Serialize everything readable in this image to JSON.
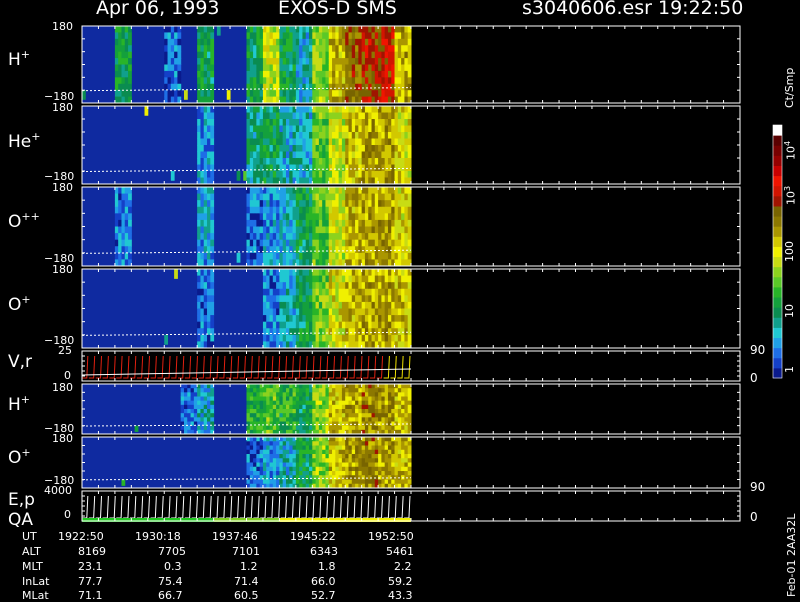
{
  "header": {
    "date": "Apr 06, 1993",
    "instrument": "EXOS-D SMS",
    "file": "s3040606.esr",
    "time": "19:22:50"
  },
  "colorbar": {
    "title": "Ct/Smp",
    "tick_labels": [
      "1",
      "10",
      "100",
      "10",
      "10"
    ],
    "tick_exponents": [
      "",
      "",
      "",
      "3",
      "4"
    ],
    "colors": [
      "#0a1a8c",
      "#1440c8",
      "#1e6ee6",
      "#20a0e6",
      "#20c8d2",
      "#10a08c",
      "#0a8c50",
      "#14a03c",
      "#28b428",
      "#5ac828",
      "#8cd21e",
      "#c8dc14",
      "#f0f000",
      "#d2c800",
      "#aa9600",
      "#8c7800",
      "#786400",
      "#a01400",
      "#d21400",
      "#f01400",
      "#c80000",
      "#960000",
      "#780000",
      "#5a0000",
      "#ffffff"
    ]
  },
  "panels": [
    {
      "label": "H",
      "sup": "+",
      "ymax": "180",
      "ymin": "−180"
    },
    {
      "label": "He",
      "sup": "+",
      "ymax": "180",
      "ymin": "−180"
    },
    {
      "label": "O",
      "sup": "++",
      "ymax": "180",
      "ymin": "−180"
    },
    {
      "label": "O",
      "sup": "+",
      "ymax": "180",
      "ymin": "−180"
    },
    {
      "label": "V,r",
      "sup": "",
      "ymax": "25",
      "ymin": "0",
      "rmax": "90",
      "rmin": "0"
    },
    {
      "label": "H",
      "sup": "+",
      "ymax": "180",
      "ymin": "−180"
    },
    {
      "label": "O",
      "sup": "+",
      "ymax": "180",
      "ymin": "−180"
    },
    {
      "label": "E,p",
      "label2": "QA",
      "sup": "",
      "ymax": "4000",
      "ymin": "0",
      "rmax": "90",
      "rmin": "0"
    }
  ],
  "footer": {
    "rows": [
      {
        "key": "UT",
        "values": [
          "1922:50",
          "1930:18",
          "1937:46",
          "1945:22",
          "1952:50"
        ]
      },
      {
        "key": "ALT",
        "values": [
          "8169",
          "7705",
          "7101",
          "6343",
          "5461"
        ]
      },
      {
        "key": "MLT",
        "values": [
          "23.1",
          "0.3",
          "1.2",
          "1.8",
          "2.2"
        ]
      },
      {
        "key": "InLat",
        "values": [
          "77.7",
          "75.4",
          "71.4",
          "66.0",
          "59.2"
        ]
      },
      {
        "key": "MLat",
        "values": [
          "71.1",
          "66.7",
          "60.5",
          "52.7",
          "43.3"
        ]
      }
    ],
    "side_label": "Feb-01 2AA32L"
  },
  "chart_data": {
    "type": "heatmap",
    "title": "Apr 06, 1993   EXOS-D SMS",
    "time_labels": [
      "1922:50",
      "1930:18",
      "1937:46",
      "1945:22",
      "1952:50"
    ],
    "data_end_fraction": 0.5,
    "colorbar_units": "Ct/Smp",
    "colorbar_range": [
      1,
      10000
    ],
    "colorbar_scale": "log",
    "series": [
      {
        "name": "H+",
        "ylim": [
          -180,
          180
        ],
        "intensity_profile": [
          0.05,
          0.05,
          0.3,
          0.05,
          0.05,
          0.1,
          0.05,
          0.3,
          0.05,
          0.05,
          0.3,
          0.5,
          0.3,
          0.2,
          0.45,
          0.6,
          0.7,
          0.75,
          0.78,
          0.62
        ]
      },
      {
        "name": "He+",
        "ylim": [
          -180,
          180
        ],
        "intensity_profile": [
          0.04,
          0.04,
          0.08,
          0.04,
          0.04,
          0.05,
          0.05,
          0.15,
          0.05,
          0.05,
          0.25,
          0.3,
          0.2,
          0.2,
          0.4,
          0.5,
          0.58,
          0.62,
          0.64,
          0.55
        ]
      },
      {
        "name": "O++",
        "ylim": [
          -180,
          180
        ],
        "intensity_profile": [
          0.04,
          0.04,
          0.12,
          0.04,
          0.04,
          0.05,
          0.05,
          0.16,
          0.05,
          0.05,
          0.1,
          0.15,
          0.18,
          0.3,
          0.4,
          0.52,
          0.6,
          0.63,
          0.64,
          0.56
        ]
      },
      {
        "name": "O+",
        "ylim": [
          -180,
          180
        ],
        "intensity_profile": [
          0.04,
          0.04,
          0.08,
          0.04,
          0.04,
          0.05,
          0.05,
          0.1,
          0.05,
          0.05,
          0.08,
          0.12,
          0.2,
          0.3,
          0.42,
          0.54,
          0.6,
          0.62,
          0.63,
          0.57
        ]
      },
      {
        "name": "V,r",
        "ylim": [
          0,
          25
        ],
        "rlim": [
          0,
          90
        ],
        "type": "line"
      },
      {
        "name": "H+",
        "ylim": [
          -180,
          180
        ],
        "intensity_profile": [
          0.04,
          0.04,
          0.04,
          0.04,
          0.04,
          0.05,
          0.1,
          0.2,
          0.05,
          0.05,
          0.35,
          0.4,
          0.35,
          0.3,
          0.45,
          0.58,
          0.62,
          0.66,
          0.64,
          0.6
        ]
      },
      {
        "name": "O+",
        "ylim": [
          -180,
          180
        ],
        "intensity_profile": [
          0.04,
          0.04,
          0.04,
          0.04,
          0.04,
          0.04,
          0.05,
          0.06,
          0.05,
          0.05,
          0.1,
          0.16,
          0.2,
          0.3,
          0.45,
          0.6,
          0.64,
          0.66,
          0.63,
          0.6
        ]
      },
      {
        "name": "E,p",
        "ylim": [
          0,
          4000
        ],
        "rlim": [
          0,
          90
        ],
        "type": "line"
      }
    ]
  }
}
